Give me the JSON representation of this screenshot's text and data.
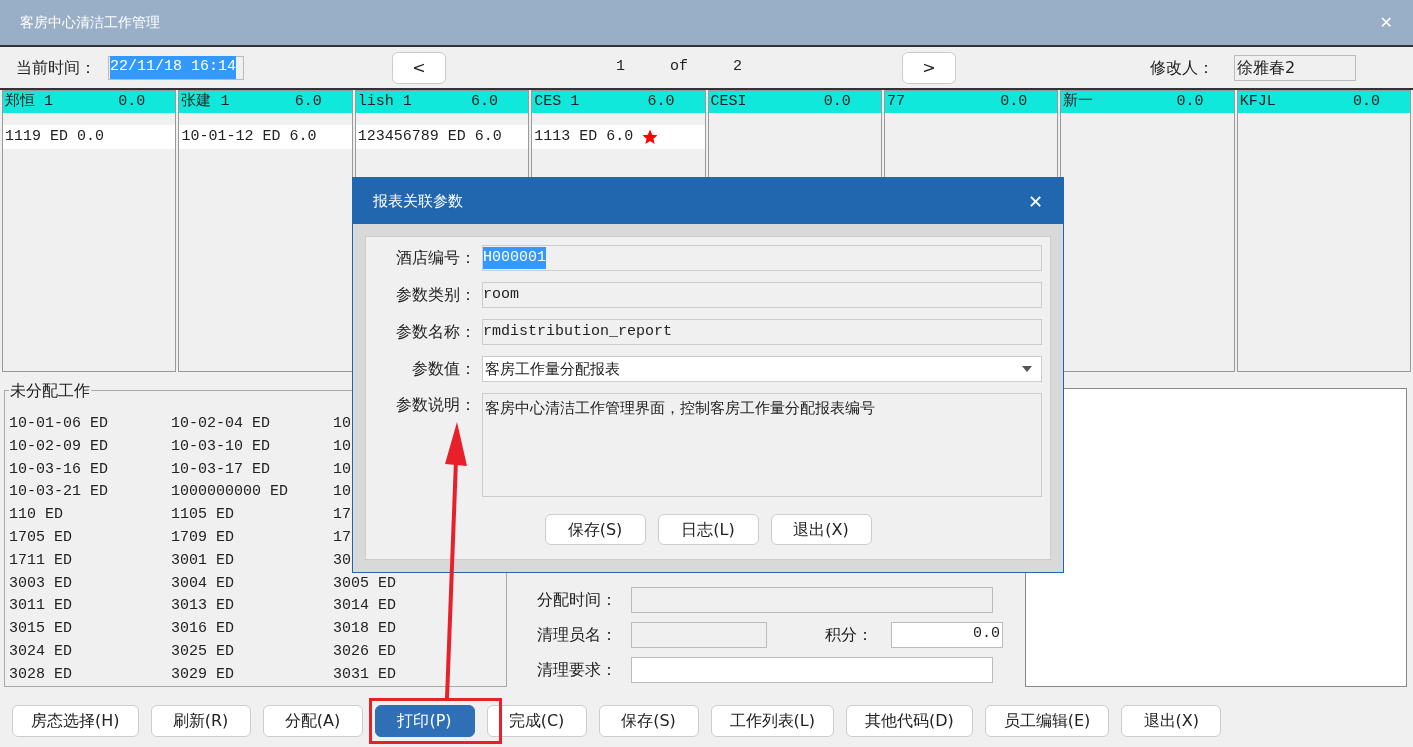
{
  "window": {
    "title": "客房中心清洁工作管理",
    "close": "✕"
  },
  "toolbar": {
    "time_label": "当前时间：",
    "time_value": "22/11/18 16:14",
    "time_highlighted": true,
    "prev": "<",
    "page": "1",
    "of": "of",
    "total": "2",
    "next": ">",
    "editor_label": "修改人：",
    "editor_value": "徐雅春2"
  },
  "staff": [
    {
      "name": "郑恒 1",
      "score": "0.0",
      "rooms": [
        {
          "text": "1119 ED 0.0",
          "starred": false
        }
      ]
    },
    {
      "name": "张建 1",
      "score": "6.0",
      "rooms": [
        {
          "text": "10-01-12 ED 6.0",
          "starred": false
        }
      ]
    },
    {
      "name": "lish 1",
      "score": "6.0",
      "rooms": [
        {
          "text": "123456789 ED 6.0",
          "starred": false
        }
      ]
    },
    {
      "name": "CES 1",
      "score": "6.0",
      "rooms": [
        {
          "text": "1113 ED 6.0",
          "starred": true
        }
      ]
    },
    {
      "name": "CESI",
      "score": "0.0"
    },
    {
      "name": "77",
      "score": "0.0"
    },
    {
      "name": "新一",
      "score": "0.0"
    },
    {
      "name": "KFJL",
      "score": "0.0"
    }
  ],
  "unassigned": {
    "title": "未分配工作",
    "items": [
      "10-01-06 ED",
      "10-02-04 ED",
      "10",
      "10-02-09 ED",
      "10-03-10 ED",
      "10",
      "10-03-16 ED",
      "10-03-17 ED",
      "10",
      "10-03-21 ED",
      "1000000000 ED",
      "10",
      "110 ED",
      "1105 ED",
      "17",
      "1705 ED",
      "1709 ED",
      "17",
      "1711 ED",
      "3001 ED",
      "30",
      "3003 ED",
      "3004 ED",
      "3005 ED",
      "3011 ED",
      "3013 ED",
      "3014 ED",
      "3015 ED",
      "3016 ED",
      "3018 ED",
      "3024 ED",
      "3025 ED",
      "3026 ED",
      "3028 ED",
      "3029 ED",
      "3031 ED"
    ]
  },
  "detail": {
    "assign_time_label": "分配时间：",
    "cleaner_label": "清理员名：",
    "points_label": "积分：",
    "points_value": "0.0",
    "requirement_label": "清理要求："
  },
  "buttons": [
    {
      "label": "房态选择(H)",
      "selected": false
    },
    {
      "label": "刷新(R)",
      "selected": false
    },
    {
      "label": "分配(A)",
      "selected": false
    },
    {
      "label": "打印(P)",
      "selected": true
    },
    {
      "label": "完成(C)",
      "selected": false
    },
    {
      "label": "保存(S)",
      "selected": false
    },
    {
      "label": "工作列表(L)",
      "selected": false
    },
    {
      "label": "其他代码(D)",
      "selected": false
    },
    {
      "label": "员工编辑(E)",
      "selected": false
    },
    {
      "label": "退出(X)",
      "selected": false
    }
  ],
  "dialog": {
    "title": "报表关联参数",
    "close": "✕",
    "fields": [
      {
        "label": "酒店编号：",
        "value": "H000001",
        "kind": "text",
        "highlighted": true
      },
      {
        "label": "参数类别：",
        "value": "room",
        "kind": "text",
        "highlighted": false
      },
      {
        "label": "参数名称：",
        "value": "rmdistribution_report",
        "kind": "text",
        "highlighted": false
      },
      {
        "label": "参数值：",
        "value": "客房工作量分配报表",
        "kind": "select",
        "highlighted": false
      },
      {
        "label": "参数说明：",
        "value": "客房中心清洁工作管理界面，控制客房工作量分配报表编号",
        "kind": "memo",
        "highlighted": false
      }
    ],
    "buttons": [
      "保存(S)",
      "日志(L)",
      "退出(X)"
    ]
  }
}
